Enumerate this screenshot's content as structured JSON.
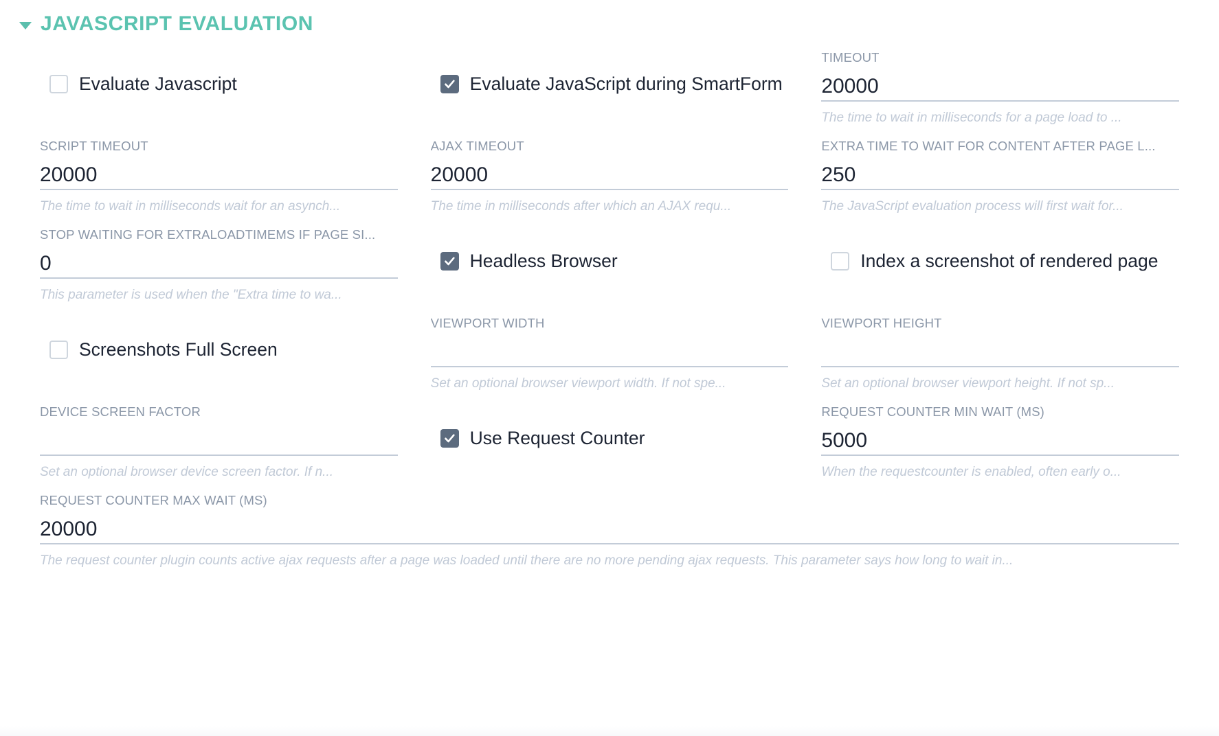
{
  "section": {
    "title": "JAVASCRIPT EVALUATION",
    "expanded": true,
    "caret_icon": "caret-down-icon",
    "accent_color": "#5bc3b0"
  },
  "theme": {
    "label_color": "#8b97a8",
    "value_color": "#1d2433",
    "help_color": "#c0c9d6",
    "underline_color": "#c3ccd8",
    "checkbox_checked_color": "#5c6b7e",
    "checkbox_border_color": "#cfd6de"
  },
  "fields": {
    "evaluate_javascript": {
      "label": "Evaluate Javascript",
      "checked": false
    },
    "evaluate_javascript_smartform": {
      "label": "Evaluate JavaScript during SmartForm",
      "checked": true
    },
    "timeout": {
      "label": "TIMEOUT",
      "value": "20000",
      "help": "The time to wait in milliseconds for a page load to ..."
    },
    "script_timeout": {
      "label": "SCRIPT TIMEOUT",
      "value": "20000",
      "help": "The time to wait in milliseconds wait for an asynch..."
    },
    "ajax_timeout": {
      "label": "AJAX TIMEOUT",
      "value": "20000",
      "help": "The time in milliseconds after which an AJAX requ..."
    },
    "extra_time_content": {
      "label": "EXTRA TIME TO WAIT FOR CONTENT AFTER PAGE L...",
      "value": "250",
      "help": "The JavaScript evaluation process will first wait for..."
    },
    "stop_waiting_extraloadtimems": {
      "label": "STOP WAITING FOR EXTRALOADTIMEMS IF PAGE SI...",
      "value": "0",
      "help": "This parameter is used when the \"Extra time to wa..."
    },
    "headless_browser": {
      "label": "Headless Browser",
      "checked": true
    },
    "index_screenshot": {
      "label": "Index a screenshot of rendered page",
      "checked": false
    },
    "screenshots_full_screen": {
      "label": "Screenshots Full Screen",
      "checked": false
    },
    "viewport_width": {
      "label": "VIEWPORT WIDTH",
      "value": "",
      "help": "Set an optional browser viewport width. If not spe..."
    },
    "viewport_height": {
      "label": "VIEWPORT HEIGHT",
      "value": "",
      "help": "Set an optional browser viewport height. If not sp..."
    },
    "device_screen_factor": {
      "label": "DEVICE SCREEN FACTOR",
      "value": "",
      "help": "Set an optional browser device screen factor.  If n..."
    },
    "use_request_counter": {
      "label": "Use Request Counter",
      "checked": true
    },
    "request_counter_min_wait": {
      "label": "REQUEST COUNTER MIN WAIT (MS)",
      "value": "5000",
      "help": "When the requestcounter is enabled, often early o..."
    },
    "request_counter_max_wait": {
      "label": "REQUEST COUNTER MAX WAIT (MS)",
      "value": "20000",
      "help": "The request counter plugin counts active ajax requests after a page was loaded until there are no more pending ajax requests. This parameter says how long to wait in..."
    }
  }
}
